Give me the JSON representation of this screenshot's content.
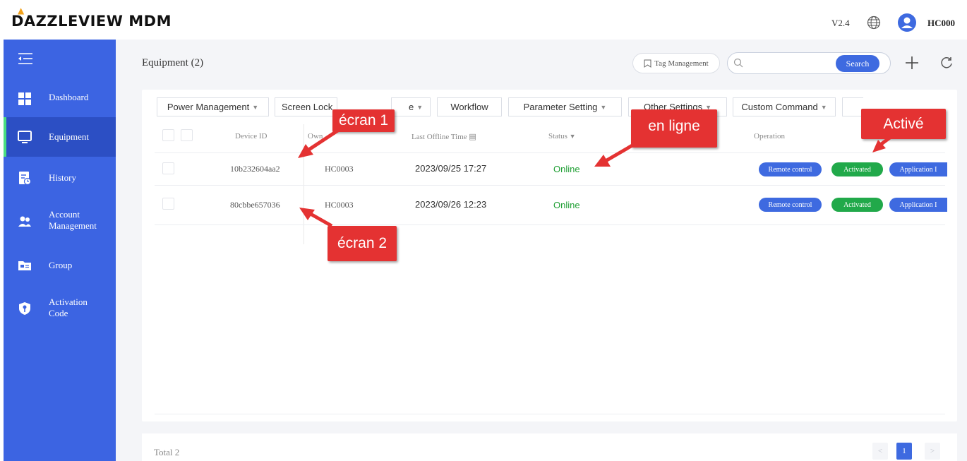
{
  "header": {
    "logo": "DAZZLEVIEW MDM",
    "version": "V2.4",
    "user": "HC000"
  },
  "sidebar": {
    "items": [
      {
        "label": "Dashboard",
        "icon": "dashboard-icon"
      },
      {
        "label": "Equipment",
        "icon": "monitor-icon",
        "active": true
      },
      {
        "label": "History",
        "icon": "history-icon"
      },
      {
        "label": "Account Management",
        "icon": "users-icon"
      },
      {
        "label": "Group",
        "icon": "folder-icon"
      },
      {
        "label": "Activation Code",
        "icon": "key-shield-icon"
      }
    ]
  },
  "main": {
    "title": "Equipment (2)",
    "tag_management": "Tag Management",
    "search": {
      "placeholder": "",
      "button": "Search"
    },
    "toolbar": [
      "Power Management",
      "Screen Lock",
      "e",
      "Workflow",
      "Parameter Setting",
      "Other Settings",
      "Custom Command"
    ],
    "columns": {
      "device_id": "Device ID",
      "owner": "Own",
      "last_offline": "Last Offline Time",
      "status": "Status",
      "operation": "Operation"
    },
    "rows": [
      {
        "device_id": "10b232604aa2",
        "owner": "HC0003",
        "last_offline": "2023/09/25 17:27",
        "status": "Online",
        "actions": [
          "Remote control",
          "Activated",
          "Application I"
        ]
      },
      {
        "device_id": "80cbbe657036",
        "owner": "HC0003",
        "last_offline": "2023/09/26 12:23",
        "status": "Online",
        "actions": [
          "Remote control",
          "Activated",
          "Application I"
        ]
      }
    ],
    "footer": {
      "total": "Total 2",
      "page": "1",
      "prev": "<",
      "next": ">"
    }
  },
  "annotations": {
    "screen1": "écran 1",
    "screen2": "écran 2",
    "online": "en ligne",
    "activated": "Activé"
  },
  "colors": {
    "sidebar": "#3c64e2",
    "accent": "#3e6ae0",
    "online": "#22a036",
    "activated": "#21a94a",
    "callout": "#e43232"
  }
}
